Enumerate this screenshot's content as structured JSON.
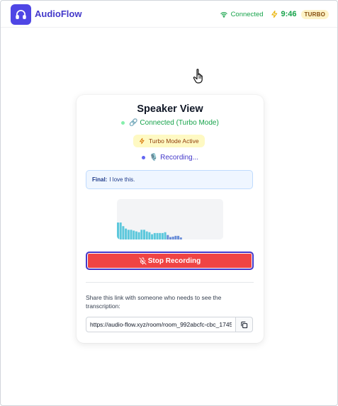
{
  "header": {
    "brand": "AudioFlow",
    "connection_status": "Connected",
    "time": "9:46",
    "turbo_badge": "TURBO"
  },
  "card": {
    "title": "Speaker View",
    "connection_line": "🔗 Connected (Turbo Mode)",
    "turbo_pill": "Turbo Mode Active",
    "recording_line": "🎙️ Recording...",
    "transcript_label": "Final:",
    "transcript_text": "I love this.",
    "stop_button": "Stop Recording",
    "share_text": "Share this link with someone who needs to see the transcription:",
    "share_url": "https://audio-flow.xyz/room/room_992abcfc-cbc_1745"
  },
  "waveform": {
    "levels": [
      0.42,
      0.42,
      0.33,
      0.27,
      0.24,
      0.24,
      0.22,
      0.2,
      0.18,
      0.24,
      0.24,
      0.2,
      0.18,
      0.13,
      0.16,
      0.16,
      0.16,
      0.16,
      0.18,
      0.11,
      0.06,
      0.07,
      0.09,
      0.09,
      0.05
    ]
  },
  "colors": {
    "brand": "#4f46e5",
    "connected": "#16a34a",
    "stop": "#ef4444",
    "wave": "#5cc8dc"
  }
}
